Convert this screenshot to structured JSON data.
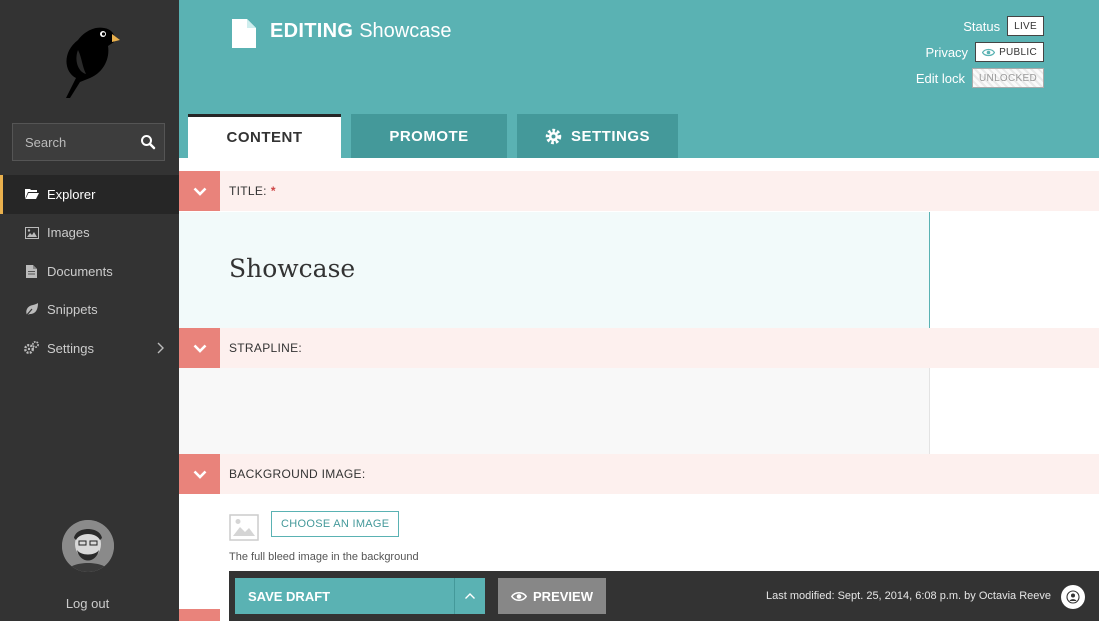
{
  "sidebar": {
    "search_placeholder": "Search",
    "items": [
      {
        "label": "Explorer",
        "icon": "folder-open-icon",
        "active": true
      },
      {
        "label": "Images",
        "icon": "image-icon"
      },
      {
        "label": "Documents",
        "icon": "document-icon"
      },
      {
        "label": "Snippets",
        "icon": "snippet-icon"
      },
      {
        "label": "Settings",
        "icon": "cogs-icon",
        "has_submenu": true
      }
    ],
    "logout_label": "Log out"
  },
  "header": {
    "title_prefix": "EDITING",
    "title": "Showcase",
    "status_label": "Status",
    "status_value": "LIVE",
    "privacy_label": "Privacy",
    "privacy_value": "PUBLIC",
    "edit_lock_label": "Edit lock",
    "edit_lock_value": "UNLOCKED",
    "tabs": [
      {
        "label": "CONTENT",
        "active": true
      },
      {
        "label": "PROMOTE"
      },
      {
        "label": "SETTINGS"
      }
    ]
  },
  "fields": {
    "title_label": "TITLE:",
    "title_required": "*",
    "title_value": "Showcase",
    "strapline_label": "STRAPLINE:",
    "strapline_value": "",
    "background_label": "BACKGROUND IMAGE:",
    "choose_image_label": "CHOOSE AN IMAGE",
    "background_help": "The full bleed image in the background"
  },
  "footer": {
    "save_label": "SAVE DRAFT",
    "preview_label": "PREVIEW",
    "last_modified": "Last modified: Sept. 25, 2014, 6:08 p.m. by Octavia Reeve"
  },
  "colors": {
    "sidebar": "#333333",
    "accent_teal": "#5ab2b3",
    "field_toggle": "#e9837b",
    "field_header": "#fdf0ee"
  }
}
